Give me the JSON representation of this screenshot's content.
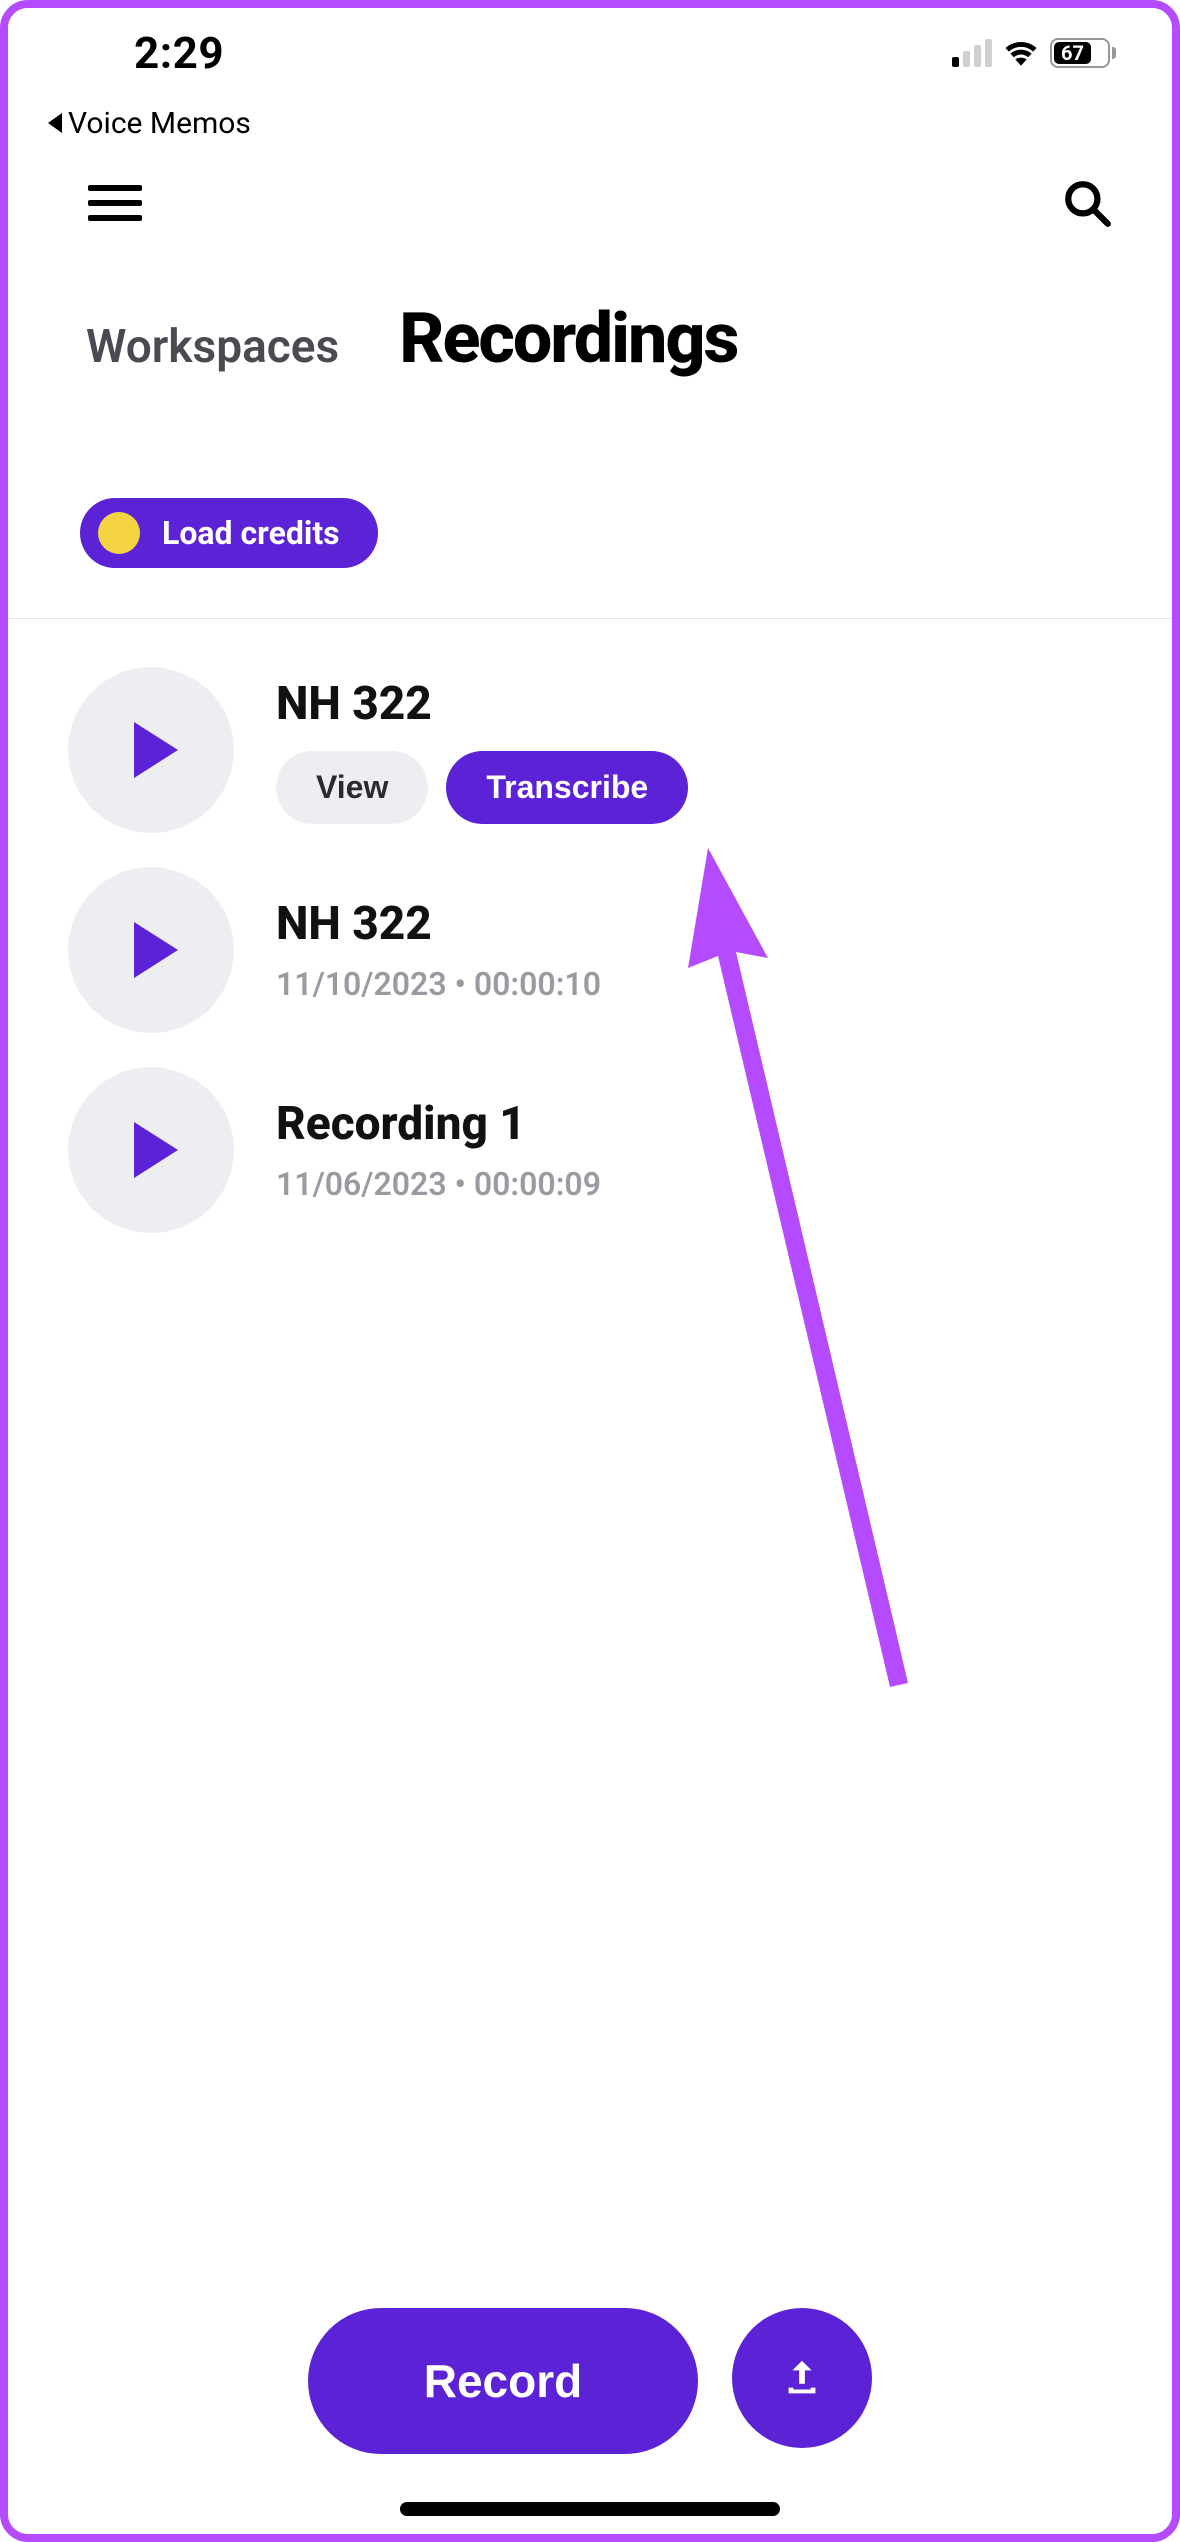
{
  "status": {
    "time": "2:29",
    "battery_pct": "67",
    "back_app": "Voice Memos"
  },
  "header": {
    "workspaces_label": "Workspaces",
    "page_title": "Recordings"
  },
  "credits": {
    "label": "Load credits"
  },
  "recordings": [
    {
      "title": "NH 322",
      "expanded": true,
      "view_label": "View",
      "transcribe_label": "Transcribe"
    },
    {
      "title": "NH 322",
      "meta": "11/10/2023 • 00:00:10"
    },
    {
      "title": "Recording 1",
      "meta": "11/06/2023 • 00:00:09"
    }
  ],
  "bottom": {
    "record_label": "Record"
  }
}
